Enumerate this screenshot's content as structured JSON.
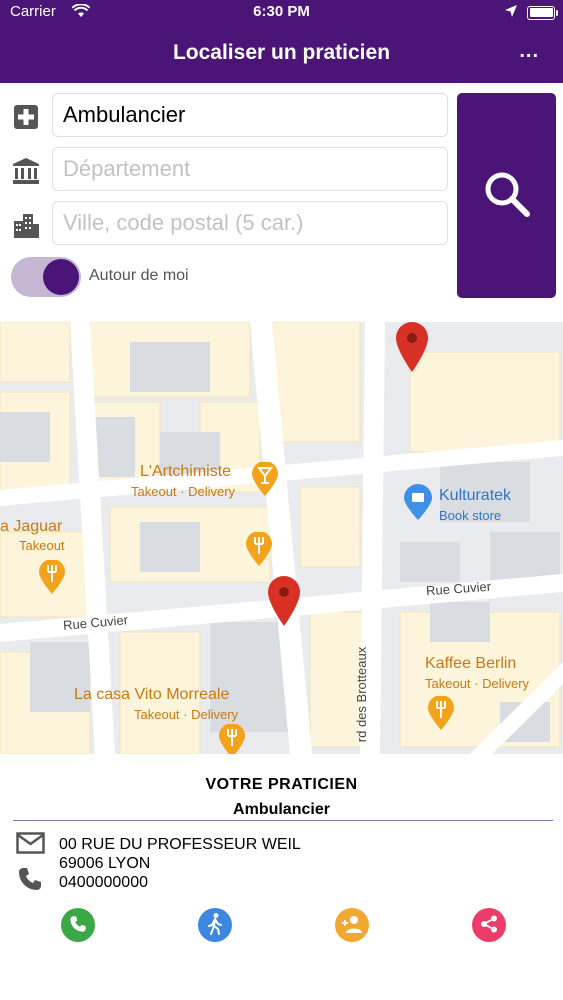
{
  "status_bar": {
    "carrier": "Carrier",
    "time": "6:30 PM"
  },
  "header": {
    "title": "Localiser un praticien",
    "more_label": "..."
  },
  "form": {
    "profession": {
      "value": "Ambulancier",
      "placeholder": ""
    },
    "department": {
      "value": "",
      "placeholder": "Département"
    },
    "city": {
      "value": "",
      "placeholder": "Ville, code postal (5 car.)"
    },
    "near_me": {
      "label": "Autour de moi",
      "enabled": true
    }
  },
  "map": {
    "streets": [
      "Rue Cuvier",
      "Rue Cuvier",
      "rd des Brotteaux"
    ],
    "places": [
      {
        "name": "L'Artchimiste",
        "sub": "Takeout · Delivery"
      },
      {
        "name": "a Jaguar",
        "sub": "Takeout"
      },
      {
        "name": "Kulturatek",
        "sub": "Book store"
      },
      {
        "name": "Kaffee Berlin",
        "sub": "Takeout · Delivery"
      },
      {
        "name": "La casa Vito Morreale",
        "sub": "Takeout · Delivery"
      }
    ]
  },
  "practitioner": {
    "heading": "VOTRE PRATICIEN",
    "profession": "Ambulancier",
    "address_line1": "00 RUE DU PROFESSEUR WEIL",
    "address_line2": "69006 LYON",
    "phone": "0400000000"
  },
  "colors": {
    "brand": "#4b1578",
    "call": "#3aa845",
    "walk": "#3d87e0",
    "add_contact": "#f0a830",
    "share": "#ec3d6a",
    "map_marker": "#d93025"
  },
  "icons": {
    "profession": "medical-cross-icon",
    "department": "institution-icon",
    "city": "city-buildings-icon",
    "search": "search-icon",
    "address": "envelope-icon",
    "phone": "phone-icon"
  }
}
